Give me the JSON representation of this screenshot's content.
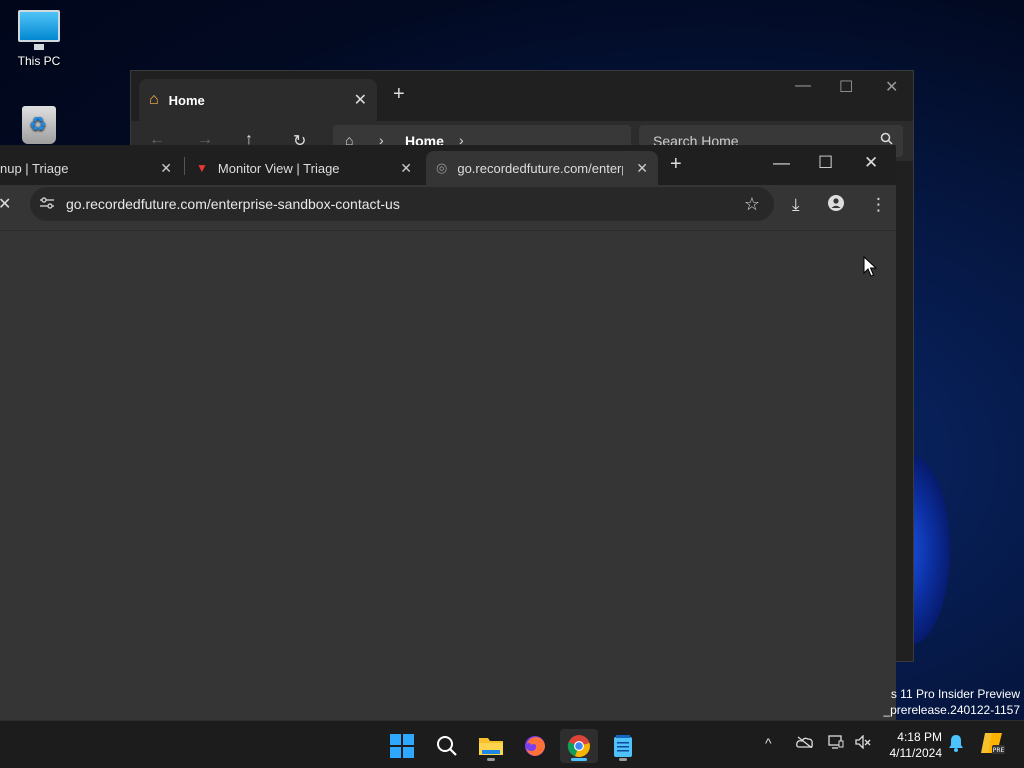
{
  "desktop": {
    "icons": [
      {
        "label": "This PC",
        "icon": "monitor-icon"
      },
      {
        "label": "",
        "icon": "recycle-bin-icon"
      }
    ],
    "watermark_line1": "s 11 Pro Insider Preview",
    "watermark_line2": "_prerelease.240122-1157"
  },
  "explorer": {
    "tab_label": "Home",
    "tab_close": "✕",
    "new_tab": "+",
    "breadcrumb": "Home",
    "search_placeholder": "Search Home",
    "min": "—",
    "max": "☐",
    "close": "✕"
  },
  "chrome": {
    "tabs": [
      {
        "label": "nup | Triage",
        "close": "✕"
      },
      {
        "label": "Monitor View | Triage",
        "close": "✕"
      },
      {
        "label": "go.recordedfuture.com/enterpr",
        "close": "✕"
      }
    ],
    "new_tab": "+",
    "min": "—",
    "max": "☐",
    "close": "✕",
    "stop": "✕",
    "url": "go.recordedfuture.com/enterprise-sandbox-contact-us",
    "accent": "#4cc2ff"
  },
  "taskbar": {
    "apps": [
      {
        "name": "start",
        "icon": "windows-logo-icon"
      },
      {
        "name": "search",
        "icon": "search-icon"
      },
      {
        "name": "file-explorer",
        "icon": "folder-icon"
      },
      {
        "name": "firefox",
        "icon": "firefox-icon"
      },
      {
        "name": "chrome",
        "icon": "chrome-icon"
      },
      {
        "name": "notepad",
        "icon": "notepad-icon"
      }
    ],
    "time": "4:18 PM",
    "date": "4/11/2024",
    "copilot_badge": "PRE"
  }
}
